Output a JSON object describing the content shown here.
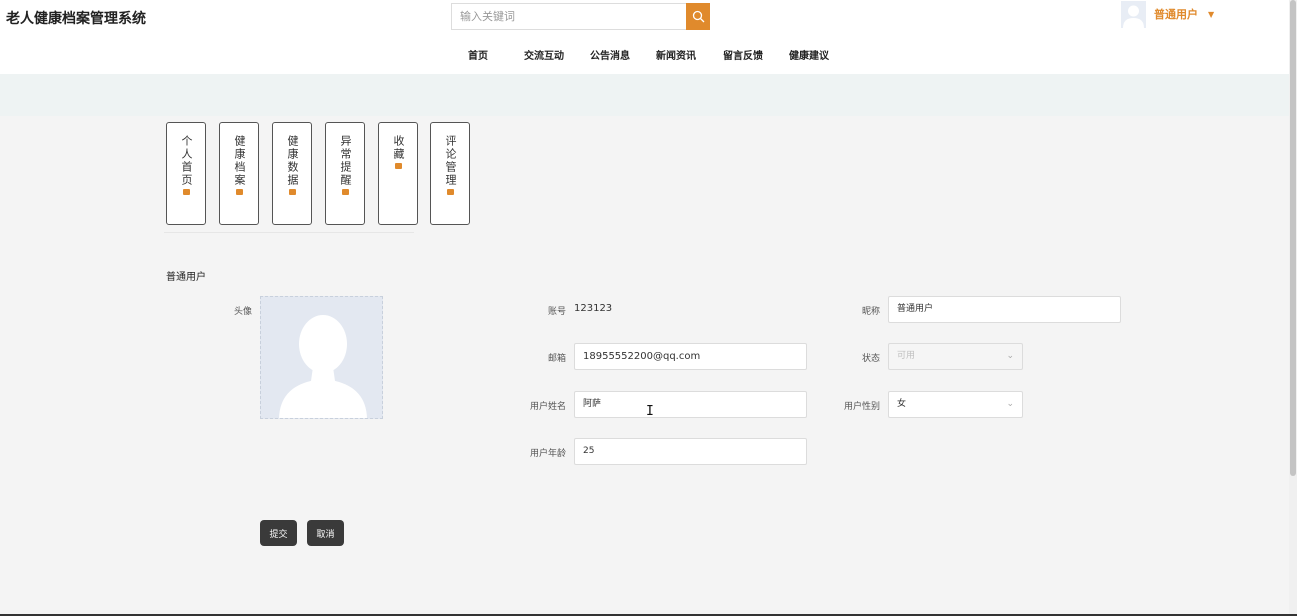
{
  "header": {
    "site_title": "老人健康档案管理系统",
    "search_placeholder": "输入关键词",
    "nav": [
      "首页",
      "交流互动",
      "公告消息",
      "新闻资讯",
      "留言反馈",
      "健康建议"
    ],
    "user_name": "普通用户",
    "accent_color": "#e08a2c"
  },
  "tabs": [
    "个人首页",
    "健康档案",
    "健康数据",
    "异常提醒",
    "收藏",
    "评论管理"
  ],
  "profile": {
    "section_title": "普通用户",
    "labels": {
      "avatar": "头像",
      "account": "账号",
      "nickname": "昵称",
      "email": "邮箱",
      "status": "状态",
      "real_name": "用户姓名",
      "gender": "用户性别",
      "age": "用户年龄"
    },
    "values": {
      "account": "123123",
      "nickname": "普通用户",
      "email": "18955552200@qq.com",
      "status": "可用",
      "real_name": "阿萨",
      "gender": "女",
      "age": "25"
    },
    "buttons": {
      "submit": "提交",
      "cancel": "取消"
    }
  },
  "icons": {
    "search": "search-icon",
    "caret": "caret-down-icon",
    "tab_marker": "hand-icon"
  }
}
